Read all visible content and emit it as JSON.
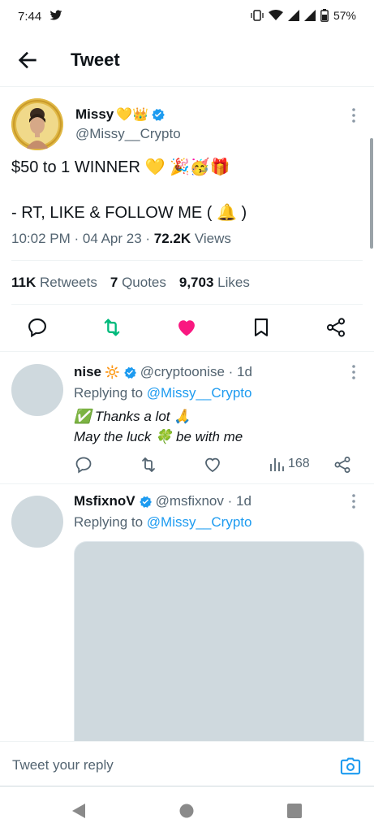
{
  "status_bar": {
    "time": "7:44",
    "battery": "57%"
  },
  "header": {
    "title": "Tweet"
  },
  "tweet": {
    "author_name": "Missy",
    "author_badges": "💛👑",
    "author_handle": "@Missy__Crypto",
    "line1_text": "$50 to 1 WINNER ",
    "line1_emoji": "💛 🎉🥳🎁",
    "line2_text": "- RT, LIKE & FOLLOW ME ( ",
    "line2_emoji": "🔔",
    "line2_end": " )",
    "time": "10:02 PM · 04 Apr 23 · ",
    "views_count": "72.2K",
    "views_label": " Views",
    "retweets_count": "11K",
    "retweets_label": "Retweets",
    "quotes_count": "7",
    "quotes_label": "Quotes",
    "likes_count": "9,703",
    "likes_label": "Likes"
  },
  "replies": [
    {
      "name": "nise",
      "name_emoji": "🔆",
      "handle": "@cryptoonise · 1d",
      "replying_prefix": "Replying to ",
      "replying_handle": "@Missy__Crypto",
      "line1_icon": "✅",
      "line1_text": " Thanks a lot ",
      "line1_emoji": "🙏",
      "line2_text": "May the luck ",
      "line2_emoji": "🍀",
      "line2_end": " be with me",
      "views": "168"
    },
    {
      "name": "MsfixnoV",
      "handle": "@msfixnov · 1d",
      "replying_prefix": "Replying to ",
      "replying_handle": "@Missy__Crypto"
    }
  ],
  "composer": {
    "placeholder": "Tweet your reply"
  },
  "colors": {
    "accent": "#1d9bf0",
    "like": "#f91880",
    "retweet": "#00ba7c",
    "verified": "#1d9bf0"
  },
  "icons": [
    "back-arrow-icon",
    "verified-icon",
    "more-icon",
    "reply-icon",
    "retweet-icon",
    "heart-icon",
    "bookmark-icon",
    "share-icon",
    "views-icon",
    "camera-icon",
    "nav-back-icon",
    "nav-home-icon",
    "nav-recents-icon",
    "twitter-bird-icon",
    "vibrate-icon",
    "wifi-icon",
    "signal-icon",
    "battery-icon"
  ]
}
